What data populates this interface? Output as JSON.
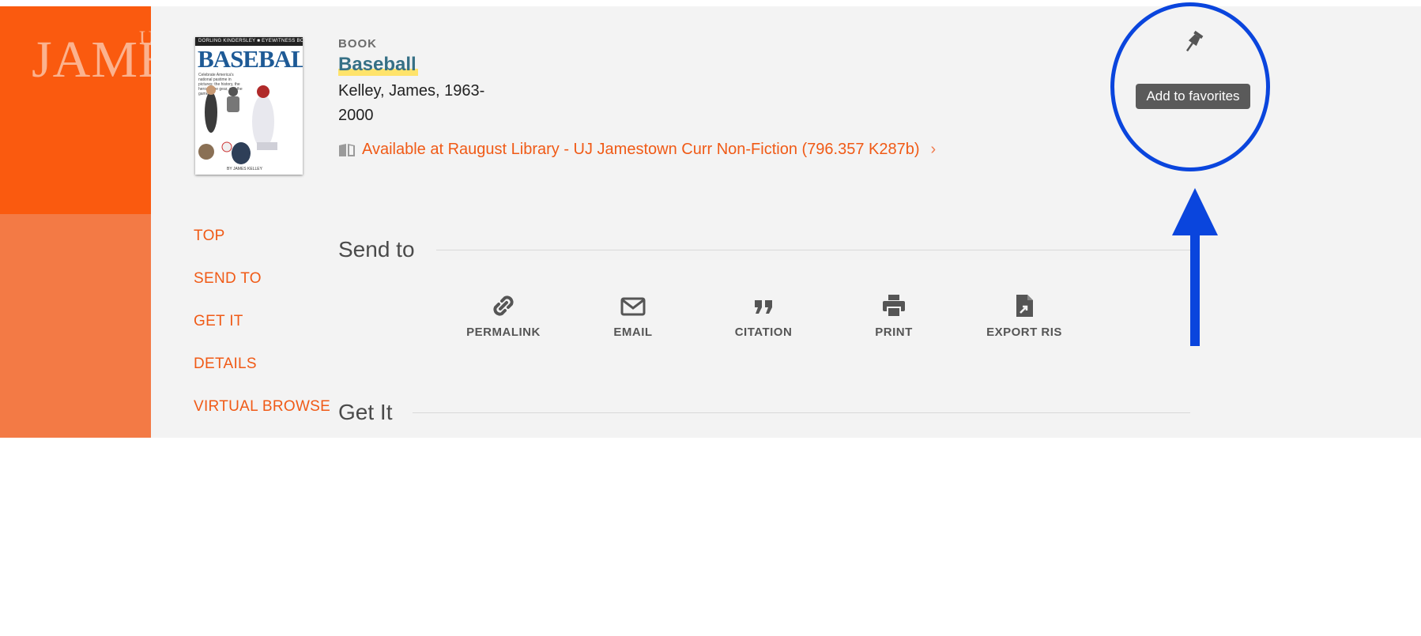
{
  "sidebar": {
    "logo_text": "JAMES",
    "logo_superscript": "U"
  },
  "record": {
    "type": "BOOK",
    "title": "Baseball",
    "author": "Kelley, James, 1963-",
    "year": "2000",
    "availability": "Available at Raugust Library - UJ Jamestown  Curr Non-Fiction (796.357 K287b)",
    "cover": {
      "publisher_band": "DORLING KINDERSLEY ■ EYEWITNESS BOOKS",
      "title": "BASEBALL",
      "blurb": "Celebrate America's national pastime in pictures: the history, the heroes, the gear, and the games",
      "author": "BY JAMES KELLEY"
    }
  },
  "nav": {
    "top": "TOP",
    "send_to": "SEND TO",
    "get_it": "GET IT",
    "details": "DETAILS",
    "virtual_browse": "VIRTUAL BROWSE"
  },
  "sections": {
    "send_to": "Send to",
    "get_it": "Get It"
  },
  "actions": {
    "permalink": "PERMALINK",
    "email": "EMAIL",
    "citation": "CITATION",
    "print": "PRINT",
    "export_ris": "EXPORT RIS"
  },
  "favorites": {
    "tooltip": "Add to favorites"
  },
  "colors": {
    "brand_orange": "#fa5a0f",
    "sidebar_orange": "#f37a45",
    "link_orange": "#f05a16",
    "title_teal": "#367086",
    "highlight_yellow": "#ffe36b",
    "annotation_blue": "#0a45dd"
  },
  "icons": {
    "pin": "pushpin-icon",
    "permalink": "link-icon",
    "email": "envelope-icon",
    "citation": "quote-icon",
    "print": "printer-icon",
    "export": "file-export-icon",
    "availability": "book-icon",
    "chevron": "chevron-right-icon",
    "scroll_top": "chevron-up-icon",
    "close": "close-icon"
  }
}
